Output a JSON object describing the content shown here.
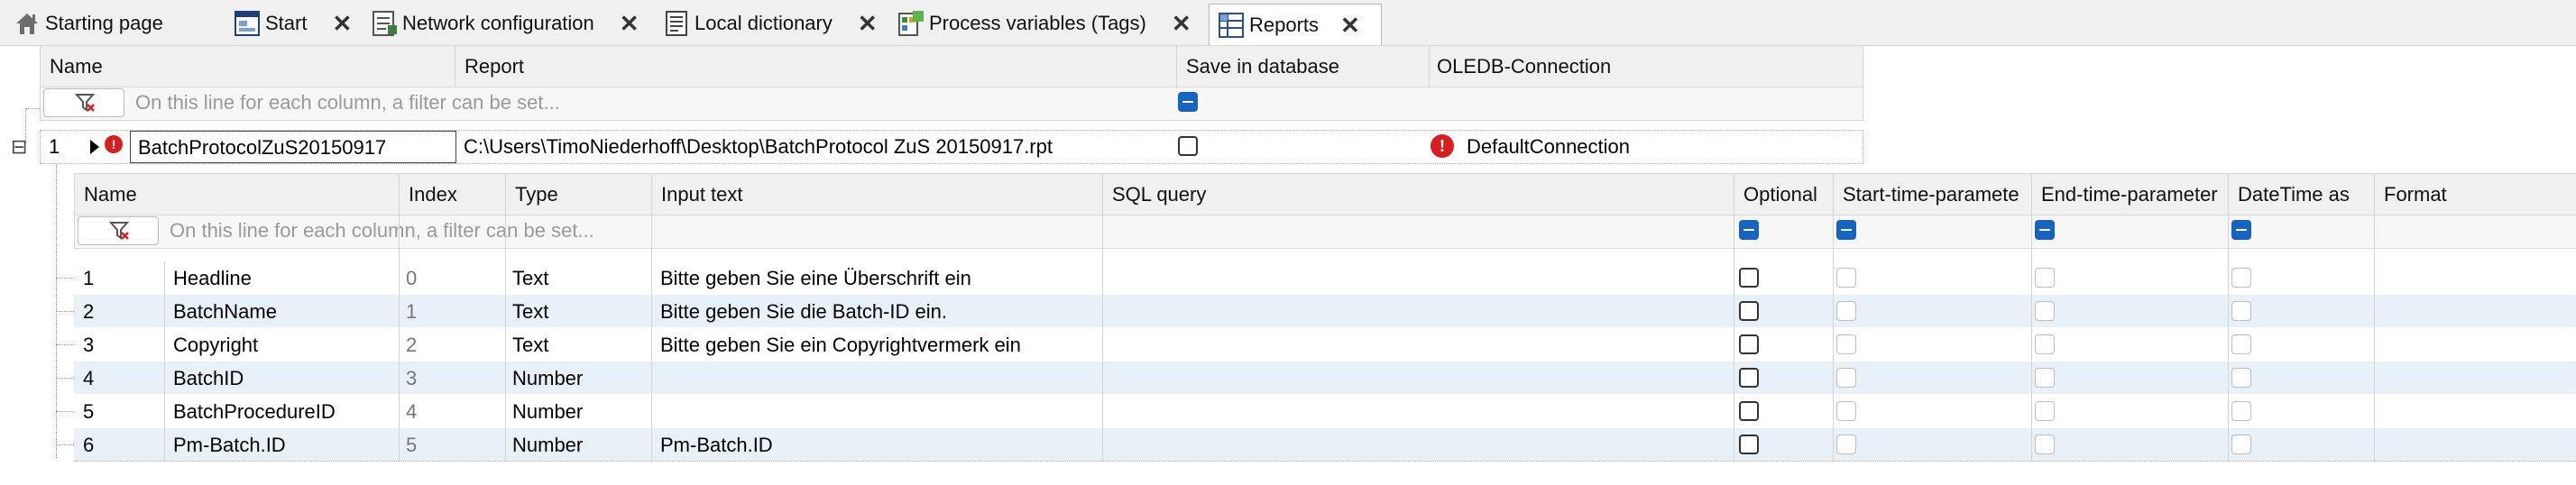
{
  "tabs": [
    {
      "label": "Starting page",
      "icon": "house-icon",
      "closable": false
    },
    {
      "label": "Start",
      "icon": "window-icon",
      "closable": true
    },
    {
      "label": "Network configuration",
      "icon": "network-icon",
      "closable": true
    },
    {
      "label": "Local dictionary",
      "icon": "book-icon",
      "closable": true
    },
    {
      "label": "Process variables (Tags)",
      "icon": "tags-icon",
      "closable": true
    },
    {
      "label": "Reports",
      "icon": "reports-icon",
      "closable": true,
      "active": true
    }
  ],
  "close_glyph": "✕",
  "outer_grid": {
    "columns": [
      "Name",
      "Report",
      "Save in database",
      "OLEDB-Connection"
    ],
    "filter_hint": "On this line for each column, a filter can be set...",
    "row": {
      "index": "1",
      "expand_glyph": "⊟",
      "name": "BatchProtocolZuS20150917",
      "report": "C:\\Users\\TimoNiederhoff\\Desktop\\BatchProtocol ZuS 20150917.rpt",
      "connection": "DefaultConnection"
    }
  },
  "inner_grid": {
    "columns": [
      "Name",
      "Index",
      "Type",
      "Input text",
      "SQL query",
      "Optional",
      "Start-time-paramete",
      "End-time-parameter",
      "DateTime as",
      "Format"
    ],
    "filter_hint": "On this line for each column, a filter can be set...",
    "rows": [
      {
        "n": "1",
        "name": "Headline",
        "index": "0",
        "type": "Text",
        "input": "Bitte geben Sie eine Überschrift ein"
      },
      {
        "n": "2",
        "name": "BatchName",
        "index": "1",
        "type": "Text",
        "input": "Bitte geben Sie die Batch-ID ein."
      },
      {
        "n": "3",
        "name": "Copyright",
        "index": "2",
        "type": "Text",
        "input": "Bitte geben Sie ein Copyrightvermerk ein"
      },
      {
        "n": "4",
        "name": "BatchID",
        "index": "3",
        "type": "Number",
        "input": ""
      },
      {
        "n": "5",
        "name": "BatchProcedureID",
        "index": "4",
        "type": "Number",
        "input": ""
      },
      {
        "n": "6",
        "name": "Pm-Batch.ID",
        "index": "5",
        "type": "Number",
        "input": "Pm-Batch.ID"
      }
    ]
  },
  "colors": {
    "accent": "#1565c0",
    "error": "#d81e1e",
    "row_alt": "#e8f0f8"
  }
}
